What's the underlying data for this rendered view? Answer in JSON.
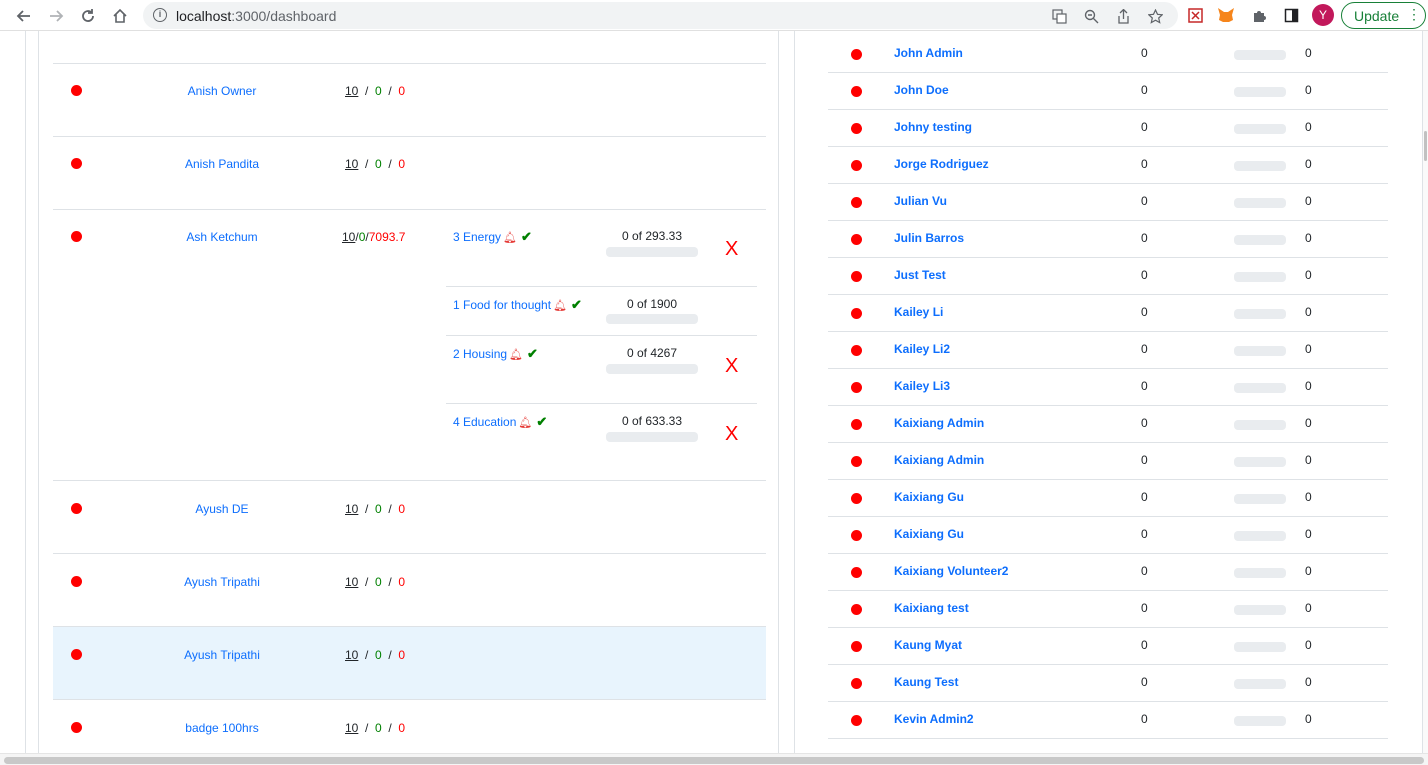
{
  "browser": {
    "url_host": "localhost",
    "url_path": ":3000/dashboard",
    "avatar_letter": "Y",
    "update_label": "Update"
  },
  "left_rows": [
    {
      "name": "Anish Owner",
      "hours": {
        "a": "10",
        "b": "0",
        "c": "0"
      }
    },
    {
      "name": "Anish Pandita",
      "hours": {
        "a": "10",
        "b": "0",
        "c": "0"
      }
    },
    {
      "name": "Ash Ketchum",
      "hours": {
        "a": "10",
        "b": "0",
        "c": "7093.7"
      }
    },
    {
      "name": "Ayush DE",
      "hours": {
        "a": "10",
        "b": "0",
        "c": "0"
      }
    },
    {
      "name": "Ayush Tripathi",
      "hours": {
        "a": "10",
        "b": "0",
        "c": "0"
      }
    },
    {
      "name": "Ayush Tripathi",
      "hours": {
        "a": "10",
        "b": "0",
        "c": "0"
      }
    },
    {
      "name": "badge 100hrs",
      "hours": {
        "a": "10",
        "b": "0",
        "c": "0"
      }
    }
  ],
  "separator": "/",
  "tasks": [
    {
      "label": "3 Energy",
      "progress": "0 of 293.33",
      "percent": 0,
      "x": "X"
    },
    {
      "label": "1 Food for thought",
      "progress": "0 of 1900",
      "percent": 0,
      "x": ""
    },
    {
      "label": "2 Housing",
      "progress": "0 of 4267",
      "percent": 0,
      "x": "X"
    },
    {
      "label": "4 Education",
      "progress": "0 of 633.33",
      "percent": 0,
      "x": "X"
    }
  ],
  "right_rows": [
    {
      "name": "John Admin",
      "v1": "0",
      "v2": "0"
    },
    {
      "name": "John Doe",
      "v1": "0",
      "v2": "0"
    },
    {
      "name": "Johny testing",
      "v1": "0",
      "v2": "0"
    },
    {
      "name": "Jorge Rodriguez",
      "v1": "0",
      "v2": "0"
    },
    {
      "name": "Julian Vu",
      "v1": "0",
      "v2": "0"
    },
    {
      "name": "Julin Barros",
      "v1": "0",
      "v2": "0"
    },
    {
      "name": "Just Test",
      "v1": "0",
      "v2": "0"
    },
    {
      "name": "Kailey Li",
      "v1": "0",
      "v2": "0"
    },
    {
      "name": "Kailey Li2",
      "v1": "0",
      "v2": "0"
    },
    {
      "name": "Kailey Li3",
      "v1": "0",
      "v2": "0"
    },
    {
      "name": "Kaixiang Admin",
      "v1": "0",
      "v2": "0"
    },
    {
      "name": "Kaixiang Admin",
      "v1": "0",
      "v2": "0"
    },
    {
      "name": "Kaixiang Gu",
      "v1": "0",
      "v2": "0"
    },
    {
      "name": "Kaixiang Gu",
      "v1": "0",
      "v2": "0"
    },
    {
      "name": "Kaixiang Volunteer2",
      "v1": "0",
      "v2": "0"
    },
    {
      "name": "Kaixiang test",
      "v1": "0",
      "v2": "0"
    },
    {
      "name": "Kaung Myat",
      "v1": "0",
      "v2": "0"
    },
    {
      "name": "Kaung Test",
      "v1": "0",
      "v2": "0"
    },
    {
      "name": "Kevin Admin2",
      "v1": "0",
      "v2": "0"
    }
  ],
  "colors": {
    "status_red": "#ff0000",
    "link_blue": "#0d6efd",
    "green": "#008000",
    "highlight_row": "#e8f4fd"
  },
  "icons": {
    "back": "back-arrow-icon",
    "forward": "forward-arrow-icon",
    "reload": "reload-icon",
    "home": "home-icon",
    "info": "info-icon",
    "translate": "translate-icon",
    "zoom": "zoom-icon",
    "share": "share-icon",
    "bookmark": "star-icon",
    "bell": "bell-icon",
    "check": "check-icon"
  }
}
